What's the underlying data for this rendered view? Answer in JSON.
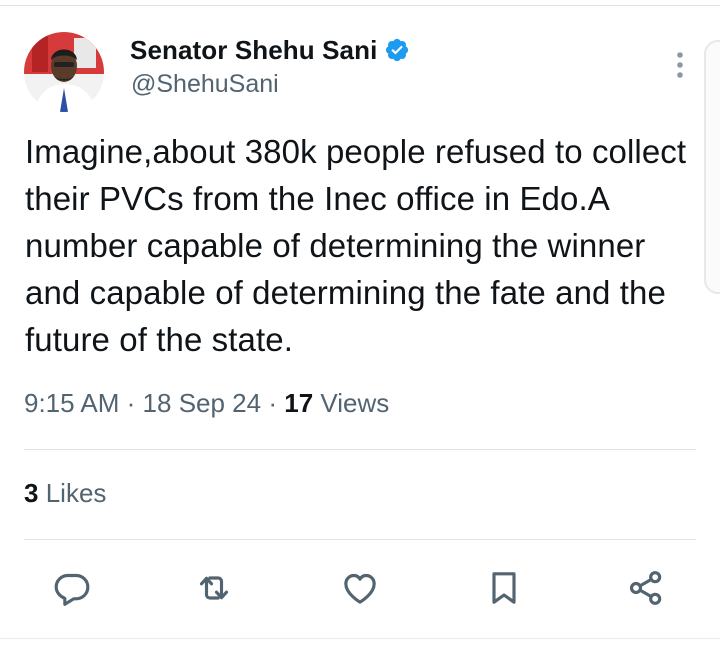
{
  "author": {
    "display_name": "Senator Shehu Sani",
    "handle": "@ShehuSani",
    "verified": true
  },
  "tweet": {
    "text": "Imagine,about 380k people refused to collect their PVCs from the Inec office in Edo.A number capable of determining the winner and capable of determining the fate and the future of the state.",
    "time": "9:15 AM",
    "date": "18 Sep 24",
    "views_count": "17",
    "views_label": "Views",
    "separator": "·"
  },
  "stats": {
    "likes_count": "3",
    "likes_label": "Likes"
  },
  "actions": [
    "reply-icon",
    "retweet-icon",
    "like-icon",
    "bookmark-icon",
    "share-icon"
  ],
  "colors": {
    "text": "#0f1419",
    "secondary": "#536471",
    "verified": "#1d9bf0",
    "divider": "#dfe3e6"
  }
}
